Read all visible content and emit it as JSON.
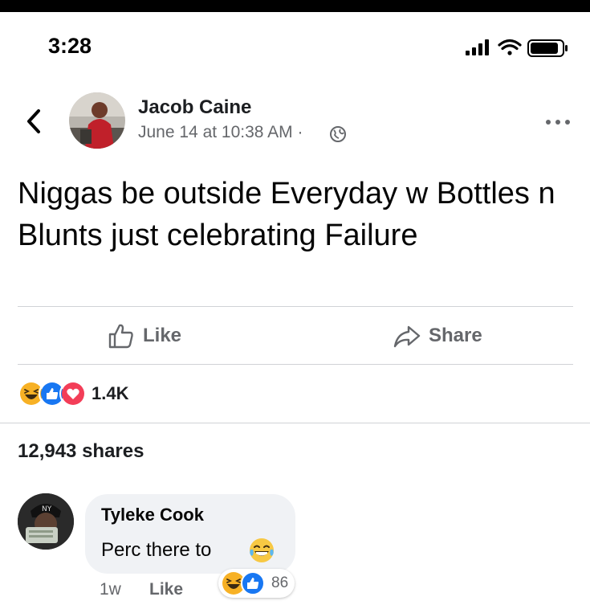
{
  "status_bar": {
    "time": "3:28",
    "icons": [
      "signal-icon",
      "wifi-icon",
      "battery-icon"
    ]
  },
  "post": {
    "back_icon": "chevron-left-icon",
    "author": "Jacob Caine",
    "date": "June 14 at 10:38 AM",
    "separator": "·",
    "privacy_icon": "globe-icon",
    "more_icon": "more-dots-icon",
    "text": "Niggas be outside Everyday w Bottles n Blunts just celebrating Failure",
    "actions": {
      "like_label": "Like",
      "share_label": "Share"
    },
    "reactions": {
      "icons": [
        "haha-icon",
        "like-icon",
        "love-icon"
      ],
      "count": "1.4K"
    },
    "shares": "12,943 shares"
  },
  "comment": {
    "author": "Tyleke Cook",
    "text": "Perc there to",
    "emoji": "laughing-tears-emoji",
    "time": "1w",
    "like_label": "Like",
    "reaction_icons": [
      "haha-icon",
      "like-icon"
    ],
    "reaction_count": "86"
  },
  "colors": {
    "like_blue": "#1877f2",
    "love_red": "#f33e58",
    "haha_yellow": "#f7b125",
    "secondary_text": "#65676b",
    "bubble_bg": "#f0f2f5"
  }
}
